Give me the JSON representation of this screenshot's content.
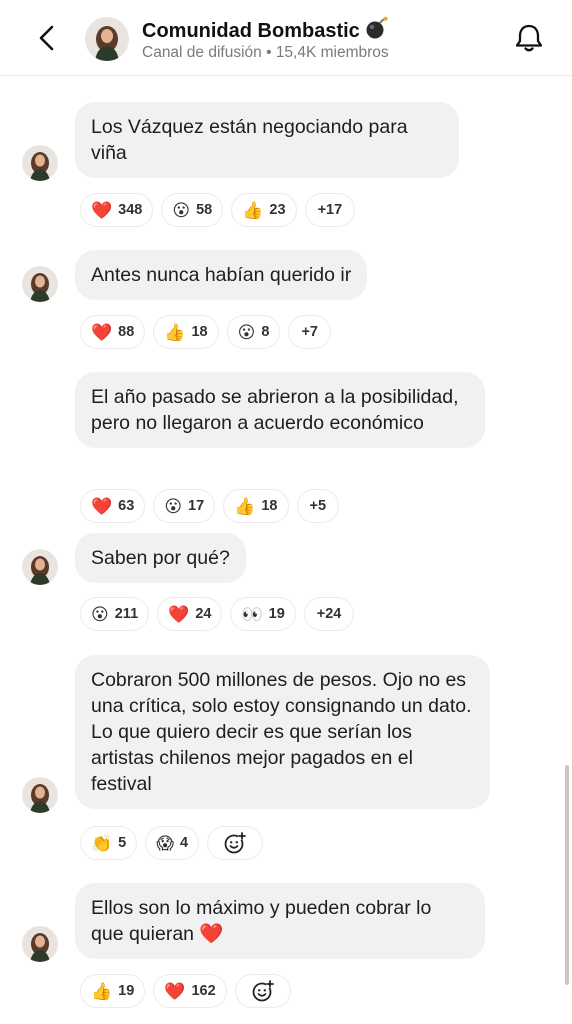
{
  "header": {
    "channel_name": "Comunidad Bombastic",
    "subtitle": "Canal de difusión • 15,4K miembros"
  },
  "icons": {
    "back": "chevron-left-icon",
    "bell": "bell-icon",
    "bomb": "bomb-emoji-icon",
    "add_reaction": "add-reaction-icon"
  },
  "messages": [
    {
      "text": "Los Vázquez están negociando para viña",
      "reactions": [
        {
          "emoji": "❤️",
          "count": "348"
        },
        {
          "emoji": "😮",
          "count": "58"
        },
        {
          "emoji": "👍",
          "count": "23"
        }
      ],
      "more": "+17"
    },
    {
      "text": "Antes nunca habían querido ir",
      "reactions": [
        {
          "emoji": "❤️",
          "count": "88"
        },
        {
          "emoji": "👍",
          "count": "18"
        },
        {
          "emoji": "😮",
          "count": "8"
        }
      ],
      "more": "+7"
    },
    {
      "text": "El año pasado se abrieron a la posibilidad, pero no llegaron a acuerdo económico",
      "reactions": [
        {
          "emoji": "❤️",
          "count": "63"
        },
        {
          "emoji": "😮",
          "count": "17"
        },
        {
          "emoji": "👍",
          "count": "18"
        }
      ],
      "more": "+5"
    },
    {
      "text": "Saben por qué?",
      "reactions": [
        {
          "emoji": "😮",
          "count": "211"
        },
        {
          "emoji": "❤️",
          "count": "24"
        },
        {
          "emoji": "👀",
          "count": "19"
        }
      ],
      "more": "+24"
    },
    {
      "text": "Cobraron 500 millones de pesos. Ojo no es una crítica, solo estoy consignando un dato. Lo que quiero decir es que serían los artistas chilenos mejor pagados en el festival",
      "reactions": [
        {
          "emoji": "👏",
          "count": "5"
        },
        {
          "emoji": "😱",
          "count": "4"
        }
      ]
    },
    {
      "text": "Ellos son lo máximo y pueden cobrar lo que quieran ❤️",
      "reactions": [
        {
          "emoji": "👍",
          "count": "19"
        },
        {
          "emoji": "❤️",
          "count": "162"
        }
      ]
    }
  ],
  "colors": {
    "bubble": "#f1f1f2",
    "subtitle": "#7a7a7a",
    "heart": "#e0212e"
  }
}
